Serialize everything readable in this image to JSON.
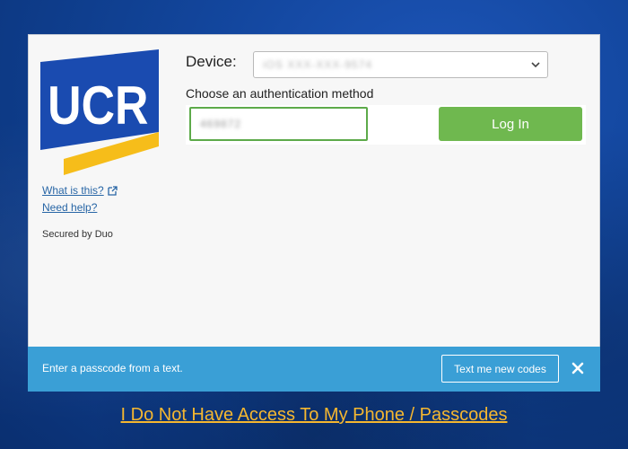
{
  "logo": {
    "text": "UCR",
    "colors": {
      "blue": "#1a4bb0",
      "gold": "#f6bd1a"
    }
  },
  "left_panel": {
    "what_is_this": "What is this?",
    "need_help": "Need help?",
    "secured_by": "Secured by Duo",
    "external_link_icon": "external-link-icon"
  },
  "form": {
    "device_label": "Device:",
    "device_value": "iOS XXX-XXX-9574",
    "method_label": "Choose an authentication method",
    "passcode_value": "469872",
    "login_label": "Log In"
  },
  "message_bar": {
    "text": "Enter a passcode from a text.",
    "button_label": "Text me new codes",
    "close_icon": "close-icon"
  },
  "footer": {
    "no_access_label": "I Do Not Have Access To My Phone / Passcodes"
  },
  "colors": {
    "background": "#13479f",
    "message_bar": "#3a9fd6",
    "login_button": "#6fb84f",
    "input_border": "#5daa4a",
    "link": "#2866a6",
    "footer_link": "#f5b730"
  }
}
